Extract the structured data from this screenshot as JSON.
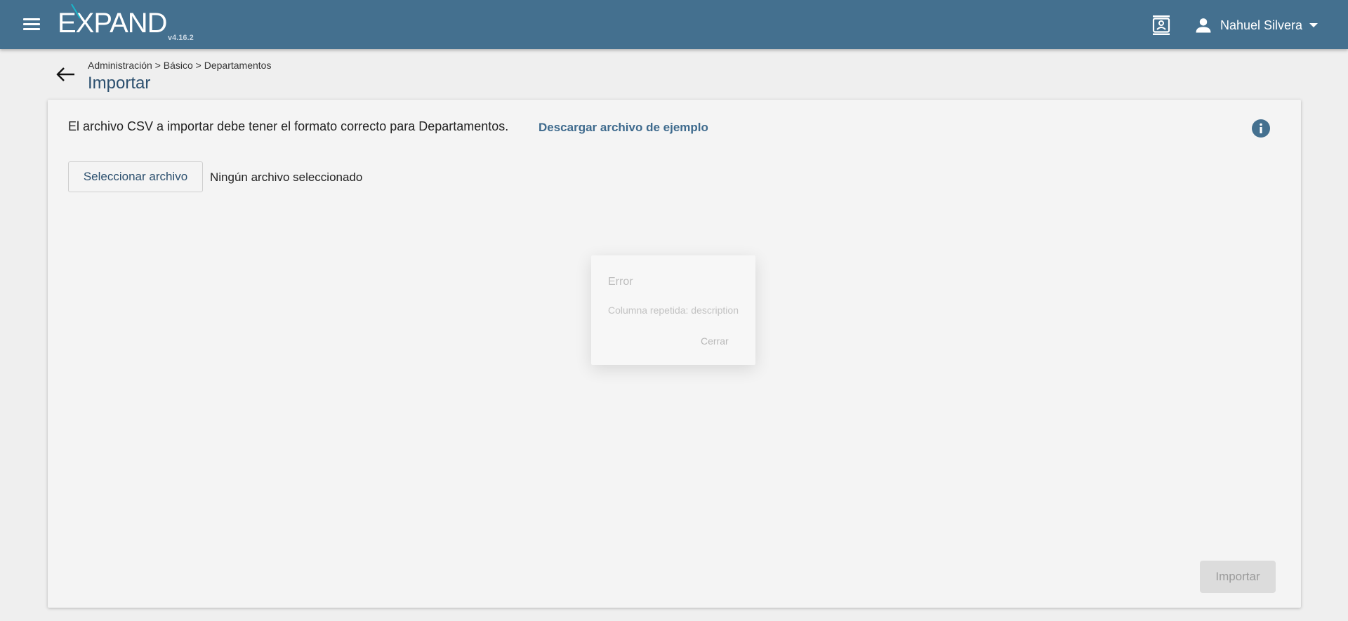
{
  "header": {
    "logo_text": "EXPAND",
    "version": "v4.16.2",
    "user_name": "Nahuel Silvera",
    "bar_color": "#44708f",
    "accent_color": "#19b6c9"
  },
  "page": {
    "breadcrumb": "Administración > Básico > Departamentos",
    "title": "Importar"
  },
  "card": {
    "info_text": "El archivo CSV a importar debe tener el formato correcto para Departamentos.",
    "download_link": "Descargar archivo de ejemplo",
    "select_file_label": "Seleccionar archivo",
    "file_status": "Ningún archivo seleccionado",
    "import_label": "Importar"
  },
  "dialog": {
    "title": "Error",
    "message": "Columna repetida: description",
    "close_label": "Cerrar"
  },
  "icons": {
    "menu": "menu-icon",
    "contacts": "contact-card-icon",
    "user": "user-icon",
    "back": "arrow-back-icon",
    "info": "info-icon"
  }
}
